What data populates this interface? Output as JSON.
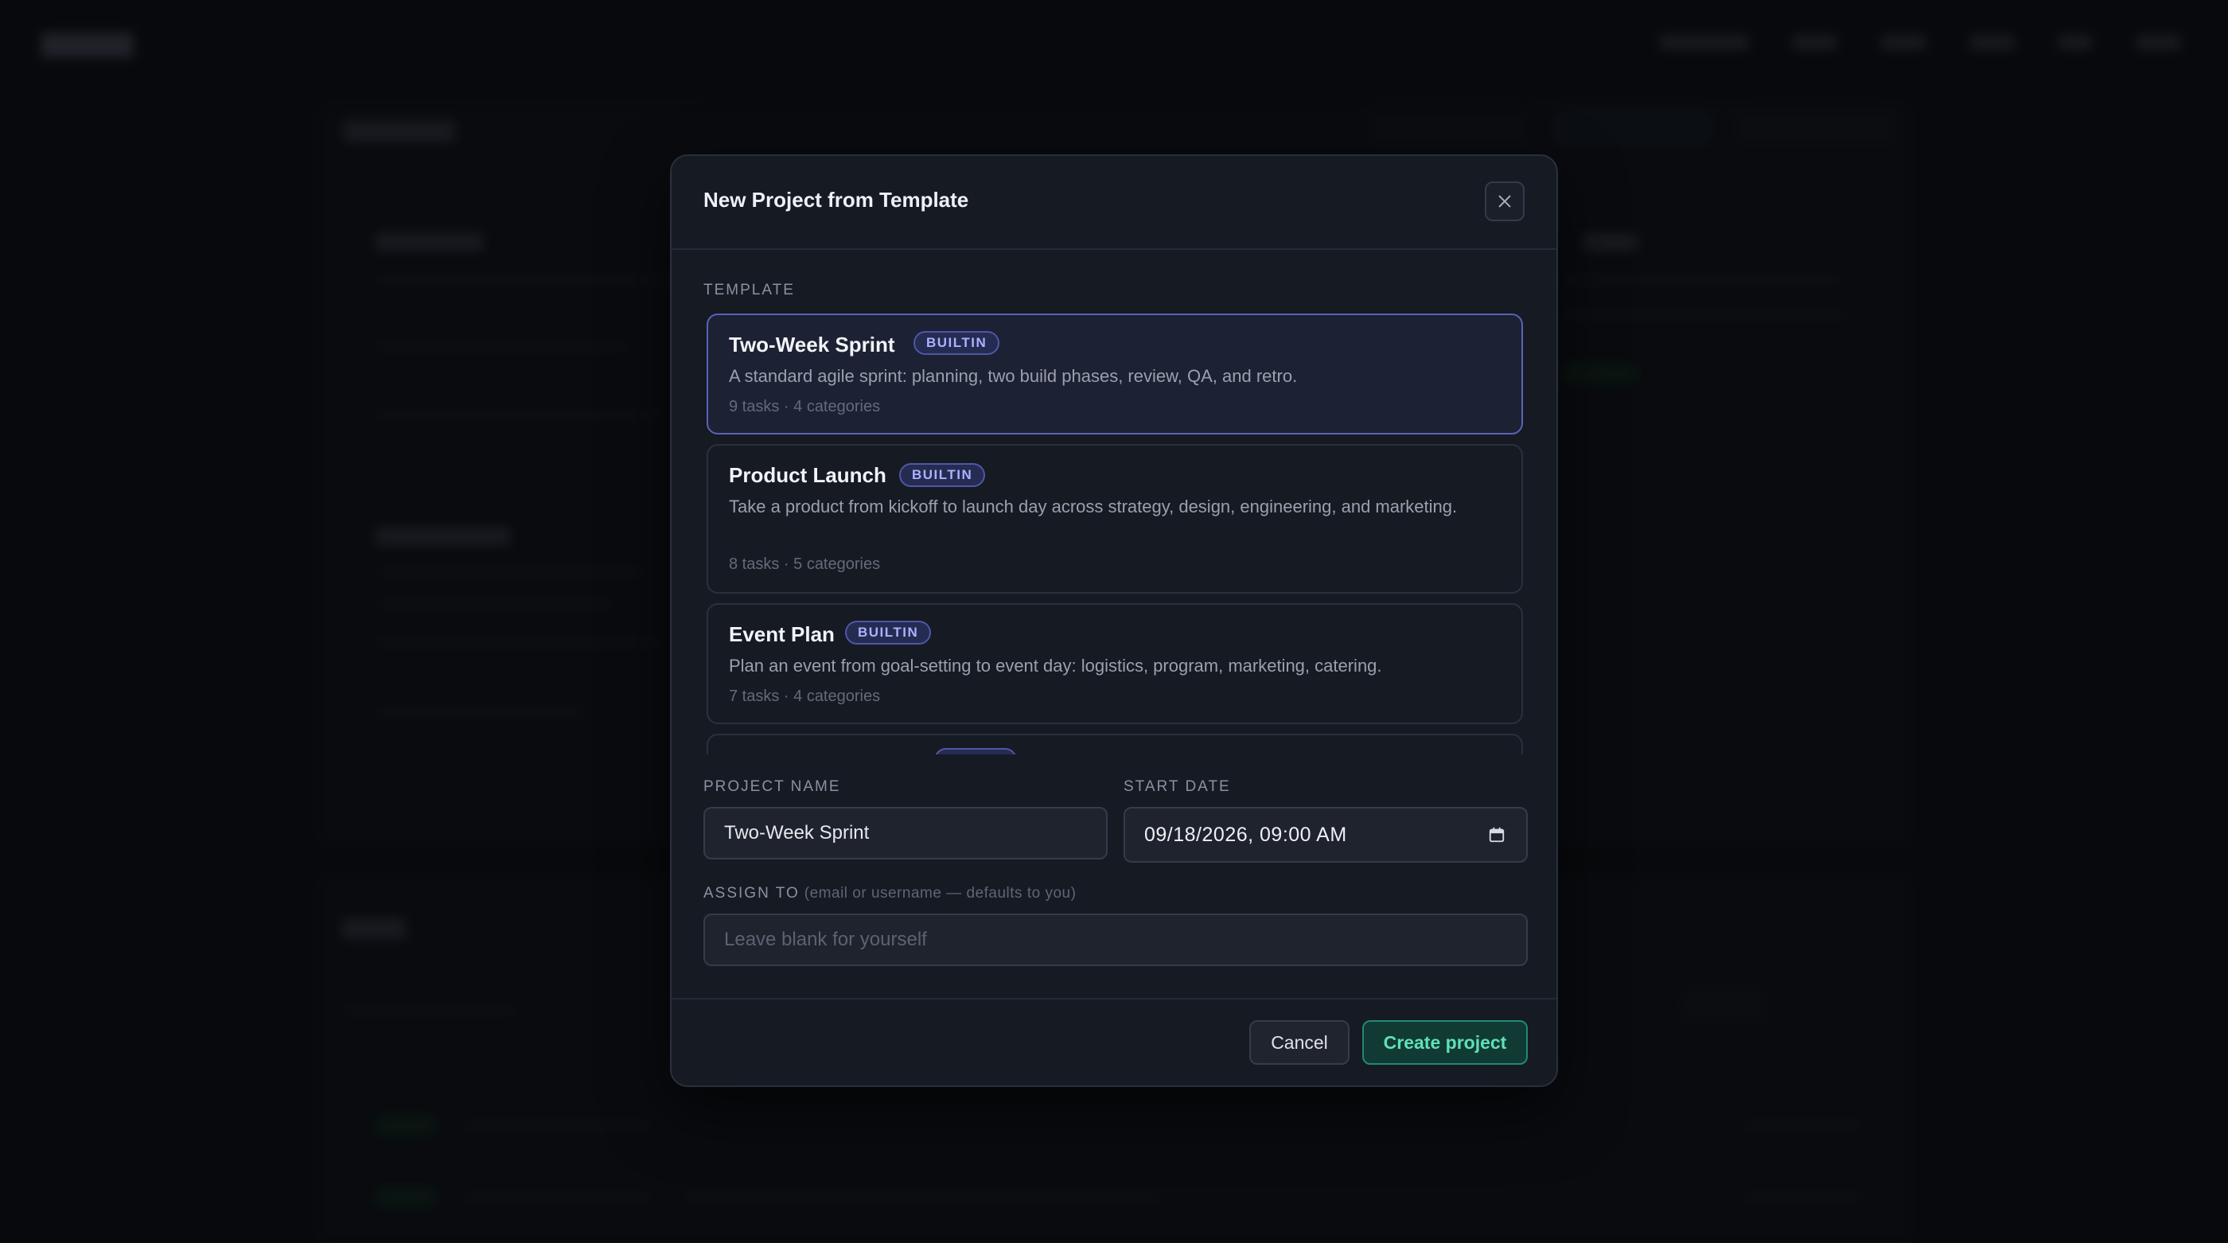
{
  "modal": {
    "title": "New Project from Template",
    "template_section_label": "TEMPLATE",
    "templates": [
      {
        "name": "Two-Week Sprint",
        "badge": "BUILTIN",
        "description": "A standard agile sprint: planning, two build phases, review, QA, and retro.",
        "meta": "9 tasks · 4 categories",
        "selected": true
      },
      {
        "name": "Product Launch",
        "badge": "BUILTIN",
        "description": "Take a product from kickoff to launch day across strategy, design, engineering, and marketing.",
        "meta": "8 tasks · 5 categories",
        "selected": false
      },
      {
        "name": "Event Plan",
        "badge": "BUILTIN",
        "description": "Plan an event from goal-setting to event day: logistics, program, marketing, catering.",
        "meta": "7 tasks · 4 categories",
        "selected": false
      }
    ],
    "project_name_label": "PROJECT NAME",
    "project_name_value": "Two-Week Sprint",
    "start_date_label": "START DATE",
    "start_date_value": "09/18/2026, 09:00 AM",
    "assign_to_label": "ASSIGN TO",
    "assign_to_hint": "(email or username — defaults to you)",
    "assign_to_placeholder": "Leave blank for yourself",
    "cancel_label": "Cancel",
    "create_label": "Create project"
  },
  "colors": {
    "accent_selected_border": "#5a62b8",
    "badge_text": "#aab2ff",
    "create_button_text": "#5fe0b8",
    "create_button_border": "#1f8a6f"
  },
  "icons": {
    "close": "close-icon",
    "calendar": "calendar-icon"
  }
}
